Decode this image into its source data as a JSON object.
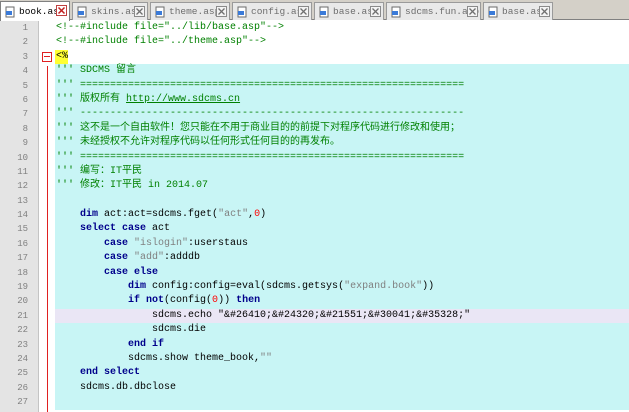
{
  "tabs": [
    {
      "label": "book.asp",
      "active": true
    },
    {
      "label": "skins.asp",
      "active": false
    },
    {
      "label": "theme.asp",
      "active": false
    },
    {
      "label": "config.asp",
      "active": false
    },
    {
      "label": "base.asp",
      "active": false
    },
    {
      "label": "sdcms.fun.asp",
      "active": false
    },
    {
      "label": "base.asp",
      "active": false
    }
  ],
  "line_numbers": [
    "1",
    "2",
    "3",
    "4",
    "5",
    "6",
    "7",
    "8",
    "9",
    "10",
    "11",
    "12",
    "13",
    "14",
    "15",
    "16",
    "17",
    "18",
    "19",
    "20",
    "21",
    "22",
    "23",
    "24",
    "25",
    "26",
    "27"
  ],
  "code": {
    "l1": "<!--#include file=\"../lib/base.asp\"-->",
    "l2": "<!--#include file=\"../theme.asp\"-->",
    "l3": "<%",
    "l4": "''' SDCMS 留言",
    "l5": "''' ================================================================",
    "l6a": "''' 版权所有 ",
    "l6b": "http://www.sdcms.cn",
    "l7": "''' ----------------------------------------------------------------",
    "l8": "''' 这不是一个自由软件！您只能在不用于商业目的的前提下对程序代码进行修改和使用；",
    "l9": "''' 未经授权不允许对程序代码以任何形式任何目的的再发布。",
    "l10": "''' ================================================================",
    "l11": "''' 编写：IT平民",
    "l12": "''' 修改：IT平民 in 2014.07",
    "l14a": "dim",
    "l14b": " act:act=sdcms.fget(",
    "l14c": "\"act\"",
    "l14d": ",",
    "l14e": "0",
    "l14f": ")",
    "l15a": "select case",
    "l15b": " act",
    "l16a": "case",
    "l16b": " \"islogin\"",
    "l16c": ":userstaus",
    "l17a": "case",
    "l17b": " \"add\"",
    "l17c": ":adddb",
    "l18a": "case else",
    "l19a": "dim",
    "l19b": " config:config=eval(sdcms.getsys(",
    "l19c": "\"expand.book\"",
    "l19d": "))",
    "l20a": "if not",
    "l20b": "(config(",
    "l20c": "0",
    "l20d": ")) ",
    "l20e": "then",
    "l21a": "sdcms.echo ",
    "l21b": "\"&#26410;&#24320;&#21551;&#30041;&#35328;\"",
    "l22a": "sdcms.die",
    "l23a": "end if",
    "l24a": "sdcms.show theme_book,",
    "l24b": "\"\"",
    "l25a": "end select",
    "l26a": "sdcms.db.dbclose"
  },
  "icons": {
    "file_icon": "file-icon",
    "close_icon": "close-icon",
    "fold_icon": "fold-minus-icon"
  },
  "colors": {
    "comment": "#008000",
    "keyword": "#00008b",
    "string": "#808080",
    "number": "#ff0000",
    "highlight_bg": "#c8f5f5",
    "current_line_bg": "#eae6f5",
    "asp_marker_bg": "#ffff33",
    "fold_line": "#e02020"
  }
}
